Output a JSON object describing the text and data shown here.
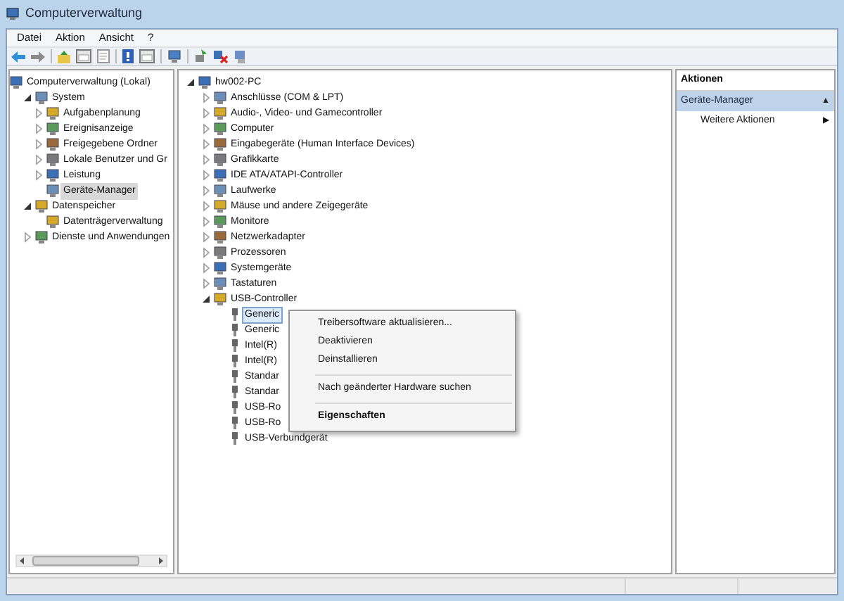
{
  "window": {
    "title": "Computerverwaltung"
  },
  "menu": [
    "Datei",
    "Aktion",
    "Ansicht",
    "?"
  ],
  "left_tree": [
    {
      "label": "Computerverwaltung (Lokal)",
      "selected": false,
      "children": [
        {
          "label": "System",
          "expanded": true,
          "selected": false,
          "children": [
            {
              "label": "Aufgabenplanung",
              "expanded": false,
              "selected": false
            },
            {
              "label": "Ereignisanzeige",
              "expanded": false,
              "selected": false
            },
            {
              "label": "Freigegebene Ordner",
              "expanded": false,
              "selected": false
            },
            {
              "label": "Lokale Benutzer und Gr",
              "expanded": false,
              "selected": false
            },
            {
              "label": "Leistung",
              "expanded": false,
              "selected": false
            },
            {
              "label": "Geräte-Manager",
              "selected": true
            }
          ]
        },
        {
          "label": "Datenspeicher",
          "expanded": true,
          "selected": false,
          "children": [
            {
              "label": "Datenträgerverwaltung",
              "selected": false
            }
          ]
        },
        {
          "label": "Dienste und Anwendungen",
          "expanded": false,
          "selected": false
        }
      ]
    }
  ],
  "device_tree": [
    {
      "label": "hw002-PC",
      "expanded": true,
      "selected": false,
      "children": [
        {
          "label": "Anschlüsse (COM & LPT)",
          "expanded": false,
          "selected": false
        },
        {
          "label": "Audio-, Video- und Gamecontroller",
          "expanded": false,
          "selected": false
        },
        {
          "label": "Computer",
          "expanded": false,
          "selected": false
        },
        {
          "label": "Eingabegeräte (Human Interface Devices)",
          "expanded": false,
          "selected": false
        },
        {
          "label": "Grafikkarte",
          "expanded": false,
          "selected": false
        },
        {
          "label": "IDE ATA/ATAPI-Controller",
          "expanded": false,
          "selected": false
        },
        {
          "label": "Laufwerke",
          "expanded": false,
          "selected": false
        },
        {
          "label": "Mäuse und andere Zeigegeräte",
          "expanded": false,
          "selected": false
        },
        {
          "label": "Monitore",
          "expanded": false,
          "selected": false
        },
        {
          "label": "Netzwerkadapter",
          "expanded": false,
          "selected": false
        },
        {
          "label": "Prozessoren",
          "expanded": false,
          "selected": false
        },
        {
          "label": "Systemgeräte",
          "expanded": false,
          "selected": false
        },
        {
          "label": "Tastaturen",
          "expanded": false,
          "selected": false
        },
        {
          "label": "USB-Controller",
          "expanded": true,
          "selected": false,
          "children": [
            {
              "label": "Generic",
              "selected": true
            },
            {
              "label": "Generic",
              "selected": false
            },
            {
              "label": "Intel(R)",
              "selected": false
            },
            {
              "label": "Intel(R)",
              "selected": false
            },
            {
              "label": "Standar",
              "selected": false
            },
            {
              "label": "Standar",
              "selected": false
            },
            {
              "label": "USB-Ro",
              "selected": false
            },
            {
              "label": "USB-Ro",
              "selected": false
            },
            {
              "label": "USB-Verbundgerät",
              "selected": false
            }
          ]
        }
      ]
    }
  ],
  "context_menu": [
    {
      "kind": "item",
      "label": "Treibersoftware aktualisieren...",
      "default": false
    },
    {
      "kind": "item",
      "label": "Deaktivieren",
      "default": false
    },
    {
      "kind": "item",
      "label": "Deinstallieren",
      "default": false
    },
    {
      "kind": "separator"
    },
    {
      "kind": "item",
      "label": "Nach geänderter Hardware suchen",
      "default": false
    },
    {
      "kind": "separator"
    },
    {
      "kind": "item",
      "label": "Eigenschaften",
      "default": true
    }
  ],
  "actions": {
    "title": "Aktionen",
    "section": {
      "label": "Geräte-Manager",
      "toggle": "▲",
      "expanded": true
    },
    "items": [
      {
        "label": "Weitere Aktionen",
        "arrow": "▶"
      }
    ]
  }
}
